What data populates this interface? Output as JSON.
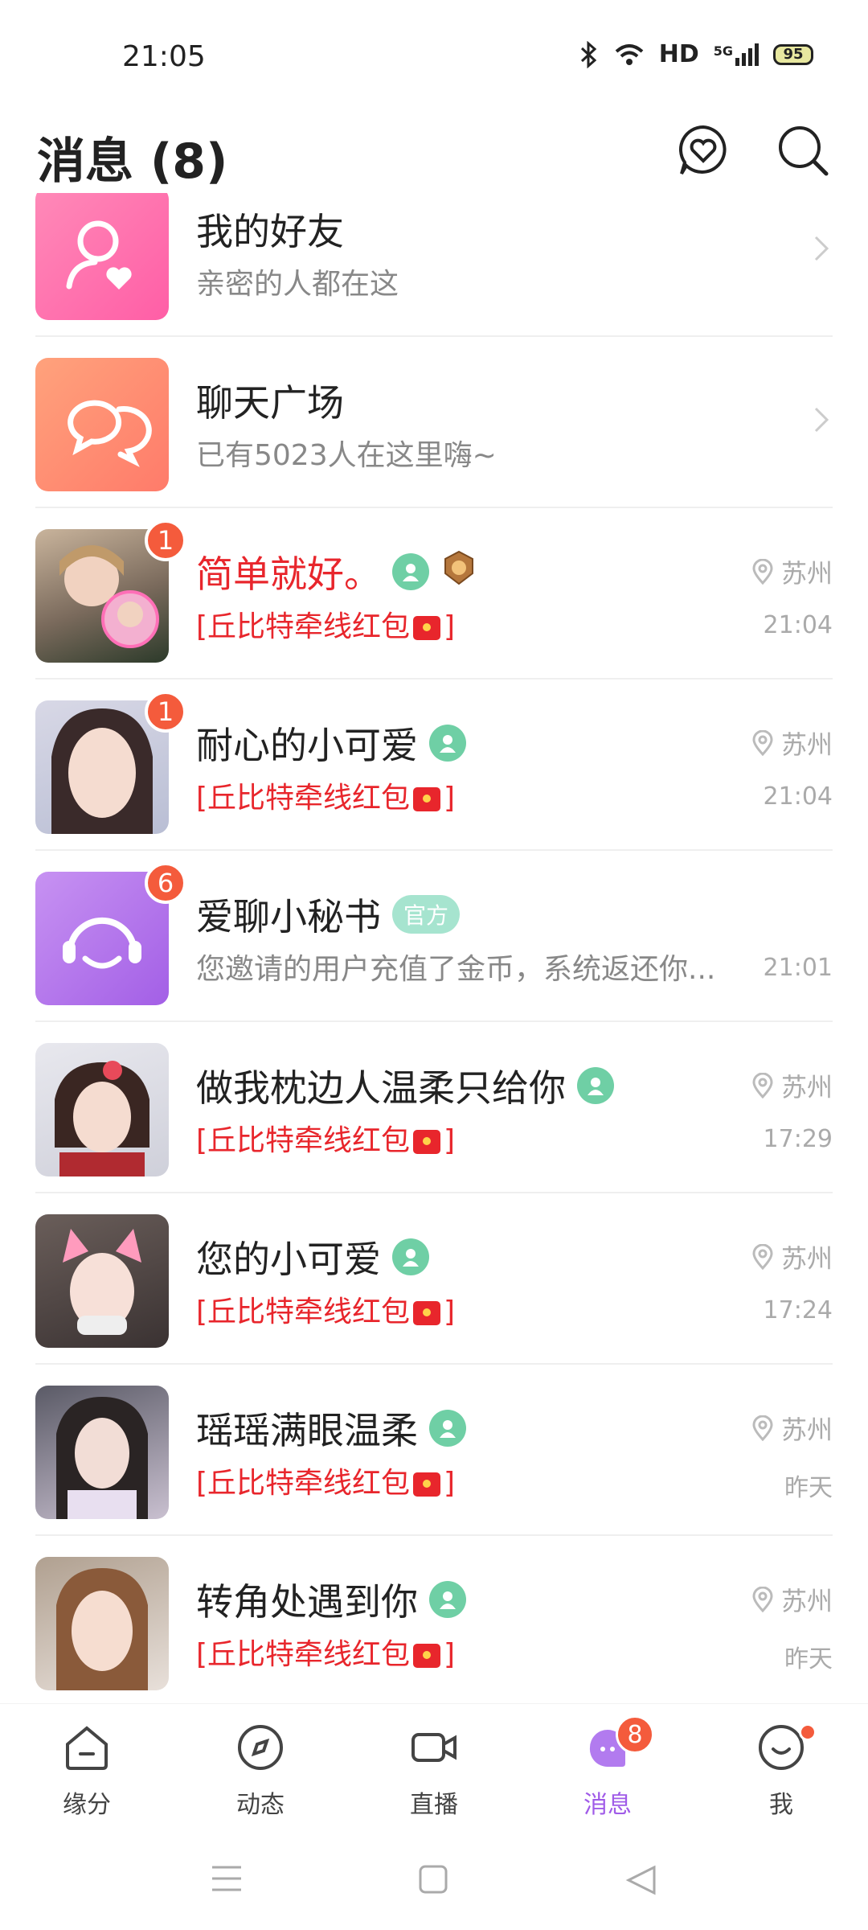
{
  "status_bar": {
    "time": "21:05",
    "network": "HD",
    "signal": "5G",
    "battery": "95"
  },
  "header": {
    "title": "消息 (8)",
    "heart_icon": "heart-chat-icon",
    "search_icon": "search-icon"
  },
  "colors": {
    "accent": "#a05be8",
    "badge": "#f45b3c",
    "red_text": "#e8262c",
    "vip_green": "#6fcfa5"
  },
  "features": [
    {
      "title": "我的好友",
      "subtitle": "亲密的人都在这",
      "icon": "friends-icon"
    },
    {
      "title": "聊天广场",
      "subtitle": "已有5023人在这里嗨~",
      "icon": "chat-square-icon"
    }
  ],
  "conversations": [
    {
      "name": "简单就好。",
      "preview": "[丘比特牵线红包",
      "preview_end": "]",
      "location": "苏州",
      "time": "21:04",
      "unread": "1"
    },
    {
      "name": "耐心的小可爱",
      "preview": "[丘比特牵线红包",
      "preview_end": "]",
      "location": "苏州",
      "time": "21:04",
      "unread": "1"
    },
    {
      "name": "爱聊小秘书",
      "tag": "官方",
      "preview": "您邀请的用户充值了金币，系统返还你...",
      "time": "21:01",
      "unread": "6"
    },
    {
      "name": "做我枕边人温柔只给你",
      "preview": "[丘比特牵线红包",
      "preview_end": "]",
      "location": "苏州",
      "time": "17:29"
    },
    {
      "name": "您的小可爱",
      "preview": "[丘比特牵线红包",
      "preview_end": "]",
      "location": "苏州",
      "time": "17:24"
    },
    {
      "name": "瑶瑶满眼温柔",
      "preview": "[丘比特牵线红包",
      "preview_end": "]",
      "location": "苏州",
      "time": "昨天"
    },
    {
      "name": "转角处遇到你",
      "preview": "[丘比特牵线红包",
      "preview_end": "]",
      "location": "苏州",
      "time": "昨天"
    }
  ],
  "tabs": [
    {
      "label": "缘分",
      "icon": "home-icon"
    },
    {
      "label": "动态",
      "icon": "compass-icon"
    },
    {
      "label": "直播",
      "icon": "video-icon"
    },
    {
      "label": "消息",
      "icon": "message-icon",
      "badge": "8",
      "active": true
    },
    {
      "label": "我",
      "icon": "smile-icon",
      "dot": true
    }
  ],
  "nav": [
    "menu-icon",
    "home-square-icon",
    "back-icon"
  ]
}
